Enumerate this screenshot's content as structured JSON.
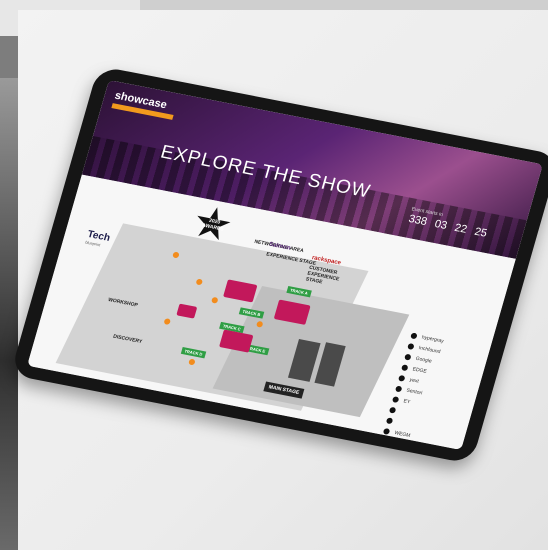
{
  "hero": {
    "brand": "showcase",
    "title": "EXPLORE THE SHOW",
    "countdown": {
      "label": "Event starts in",
      "days": "338",
      "hours": "03",
      "minutes": "22",
      "seconds": "25"
    }
  },
  "map": {
    "star_label": "2020 AWARDS",
    "networking": "NETWORKING AREA",
    "salmon": "Salmon",
    "salmon_sub": "EXPERIENCE STAGE",
    "rackspace": "rackspace",
    "rackspace_sub": "CUSTOMER EXPERIENCE STAGE",
    "tech": "Tech",
    "tech_sub": "blueprint",
    "workshop": "WORKSHOP",
    "discovery": "DISCOVERY",
    "main_stage": "MAIN STAGE",
    "tracks": [
      "TRACK A",
      "TRACK B",
      "TRACK C",
      "TRACK D",
      "TRACK E"
    ]
  },
  "legend": [
    "hypergray",
    "Inchfound",
    "Google",
    "EDGE",
    "yext",
    "Sentori",
    "EY",
    "",
    "",
    "WEGM"
  ],
  "colors": {
    "accent": "#f28c1d",
    "track": "#2f9e44",
    "pink": "#c2185b",
    "hero": "#5a2474"
  }
}
